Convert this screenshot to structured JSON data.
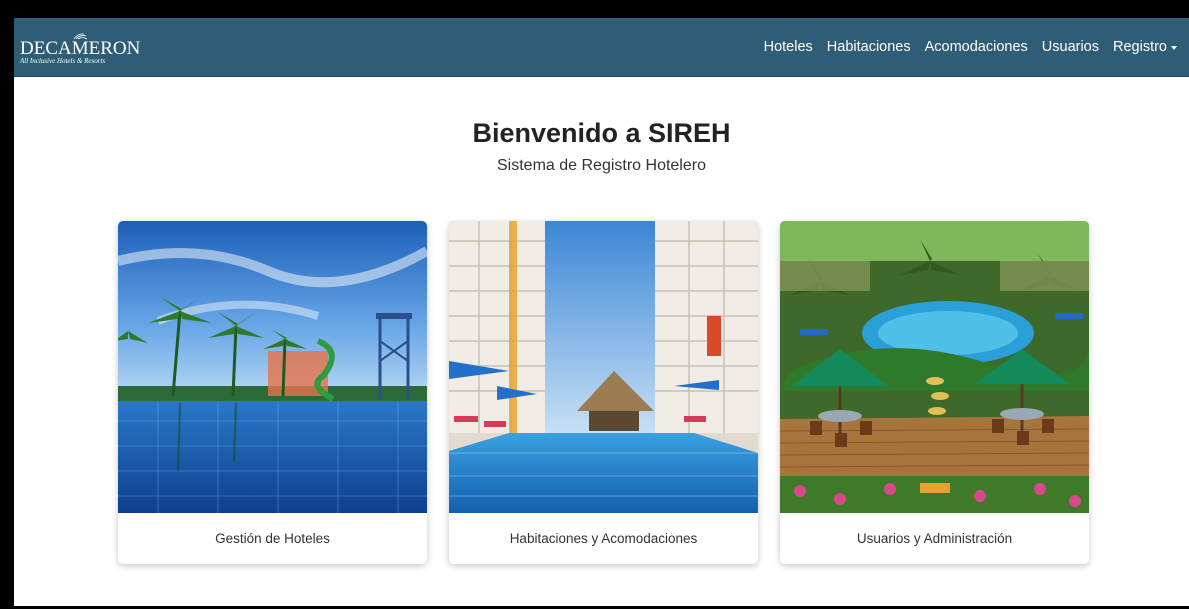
{
  "brand": {
    "name": "DECAMERON",
    "tagline": "All Inclusive Hotels & Resorts"
  },
  "nav": {
    "items": [
      {
        "label": "Hoteles"
      },
      {
        "label": "Habitaciones"
      },
      {
        "label": "Acomodaciones"
      },
      {
        "label": "Usuarios"
      },
      {
        "label": "Registro",
        "dropdown": true,
        "icon": "caret-down-icon"
      }
    ]
  },
  "hero": {
    "title": "Bienvenido a SIREH",
    "subtitle": "Sistema de Registro Hotelero"
  },
  "cards": [
    {
      "label": "Gestión de Hoteles"
    },
    {
      "label": "Habitaciones y Acomodaciones"
    },
    {
      "label": "Usuarios y Administración"
    }
  ],
  "colors": {
    "navbar": "#2e5d75",
    "background": "#ffffff"
  }
}
